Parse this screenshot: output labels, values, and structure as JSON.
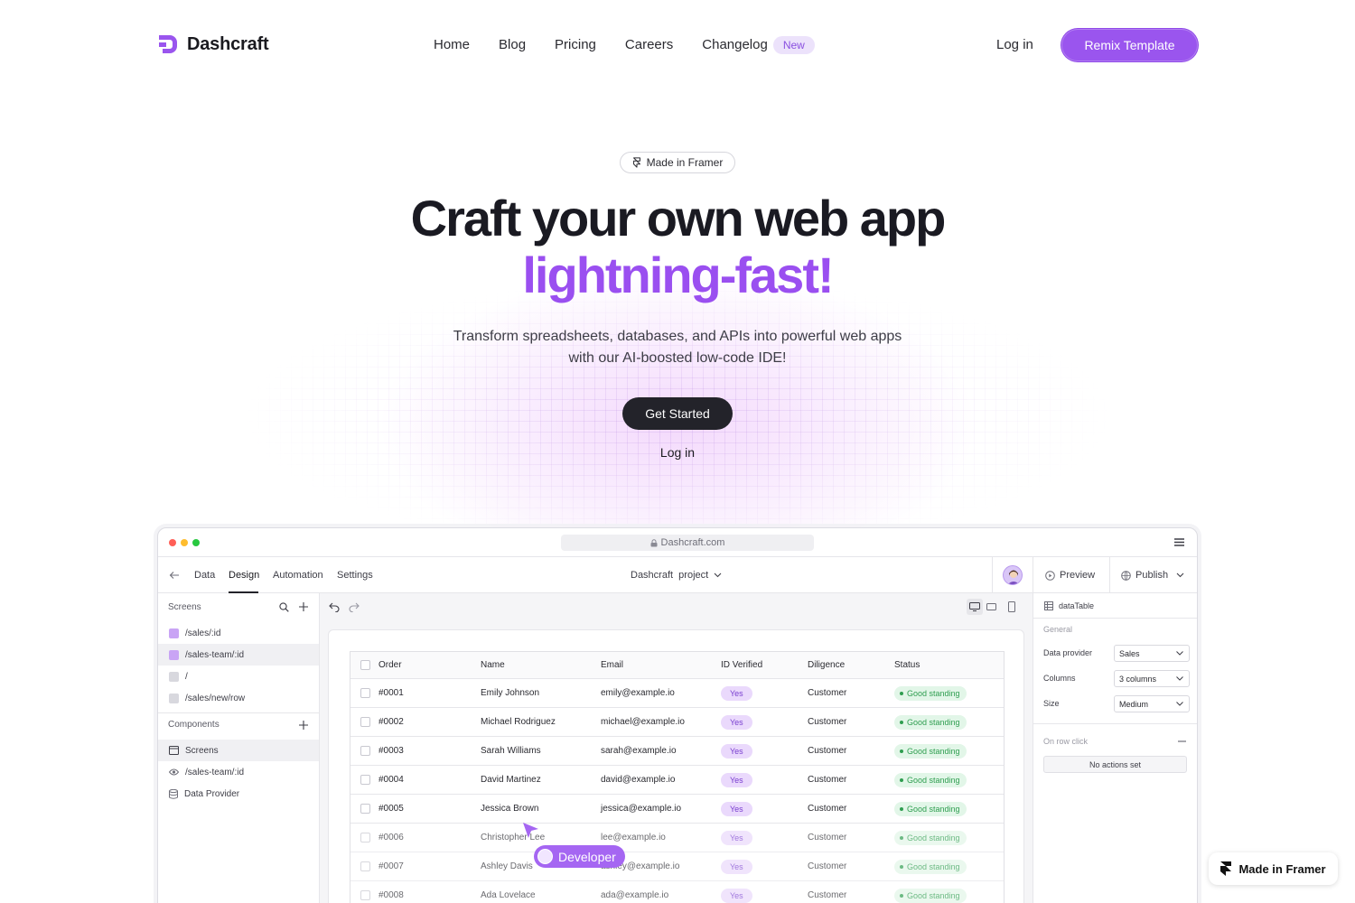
{
  "brand": {
    "name": "Dashcraft",
    "accent": "#9a55ee"
  },
  "nav": {
    "links": [
      "Home",
      "Blog",
      "Pricing",
      "Careers",
      "Changelog"
    ],
    "changelog_badge": "New",
    "login": "Log in",
    "cta": "Remix Template"
  },
  "hero": {
    "pill": "Made in Framer",
    "title_line1": "Craft your own web app",
    "title_line2": "lightning-fast!",
    "subtitle_line1": "Transform spreadsheets, databases, and APIs into powerful web apps",
    "subtitle_line2": "with our AI-boosted low-code IDE!",
    "primary_cta": "Get Started",
    "secondary_cta": "Log in"
  },
  "app": {
    "url": "Dashcraft.com",
    "tabs": [
      "Data",
      "Design",
      "Automation",
      "Settings"
    ],
    "active_tab": "Design",
    "project": "Dashcraft  project",
    "preview": "Preview",
    "publish": "Publish",
    "left": {
      "screens_title": "Screens",
      "screens": [
        {
          "label": "/sales/:id",
          "color": "#c9a4f5"
        },
        {
          "label": "/sales-team/:id",
          "color": "#c9a4f5"
        },
        {
          "label": "/",
          "color": "#d8d8de"
        },
        {
          "label": "/sales/new/row",
          "color": "#d8d8de"
        }
      ],
      "components_title": "Components",
      "components": [
        {
          "label": "Screens",
          "icon": "window-icon"
        },
        {
          "label": "/sales-team/:id",
          "icon": "eye-icon"
        },
        {
          "label": "Data Provider",
          "icon": "database-icon"
        }
      ]
    },
    "table": {
      "columns": [
        "Order",
        "Name",
        "Email",
        "ID Verified",
        "Diligence",
        "Status"
      ],
      "rows": [
        {
          "order": "#0001",
          "name": "Emily Johnson",
          "email": "emily@example.io",
          "verified": "Yes",
          "diligence": "Customer",
          "status": "Good standing"
        },
        {
          "order": "#0002",
          "name": "Michael Rodriguez",
          "email": "michael@example.io",
          "verified": "Yes",
          "diligence": "Customer",
          "status": "Good standing"
        },
        {
          "order": "#0003",
          "name": "Sarah Williams",
          "email": "sarah@example.io",
          "verified": "Yes",
          "diligence": "Customer",
          "status": "Good standing"
        },
        {
          "order": "#0004",
          "name": "David Martinez",
          "email": "david@example.io",
          "verified": "Yes",
          "diligence": "Customer",
          "status": "Good standing"
        },
        {
          "order": "#0005",
          "name": "Jessica Brown",
          "email": "jessica@example.io",
          "verified": "Yes",
          "diligence": "Customer",
          "status": "Good standing"
        },
        {
          "order": "#0006",
          "name": "Christopher Lee",
          "email": "lee@example.io",
          "verified": "Yes",
          "diligence": "Customer",
          "status": "Good standing"
        },
        {
          "order": "#0007",
          "name": "Ashley Davis",
          "email": "ashley@example.io",
          "verified": "Yes",
          "diligence": "Customer",
          "status": "Good standing"
        },
        {
          "order": "#0008",
          "name": "Ada Lovelace",
          "email": "ada@example.io",
          "verified": "Yes",
          "diligence": "Customer",
          "status": "Good standing"
        }
      ]
    },
    "right": {
      "component": "dataTable",
      "general": "General",
      "props": [
        {
          "label": "Data provider",
          "value": "Sales"
        },
        {
          "label": "Columns",
          "value": "3 columns"
        },
        {
          "label": "Size",
          "value": "Medium"
        }
      ],
      "on_row_click": "On row click",
      "no_actions": "No actions set"
    },
    "cursor_label": "Developer"
  },
  "footer_badge": "Made in Framer",
  "colors": {
    "good": "#2f9e50",
    "yes": "#7a3fd0",
    "title_purple": "#9a4ff0"
  }
}
